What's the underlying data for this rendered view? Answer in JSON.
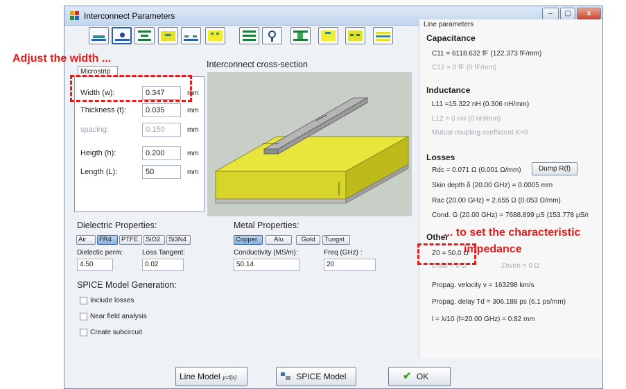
{
  "window": {
    "title": "Interconnect Parameters",
    "controls": [
      "–",
      "▢",
      "x"
    ]
  },
  "toolbar": {
    "buttons": 14,
    "selected_index": 1
  },
  "geometry": {
    "tab_label": "Microstrip",
    "section_title": "Interconnect cross-section",
    "fields": [
      {
        "label": "Width (w):",
        "value": "0.347",
        "unit": "mm",
        "enabled": true
      },
      {
        "label": "Thickness (t):",
        "value": "0.035",
        "unit": "mm",
        "enabled": true
      },
      {
        "label": "spacing:",
        "value": "0.150",
        "unit": "mm",
        "enabled": false
      },
      {
        "label": "Heigth (h):",
        "value": "0.200",
        "unit": "mm",
        "enabled": true
      },
      {
        "label": "Length (L):",
        "value": "50",
        "unit": "mm",
        "enabled": true
      }
    ]
  },
  "dielectric": {
    "title": "Dielectric Properties:",
    "chips": [
      "Air",
      "FR4",
      "PTFE",
      "SiO2",
      "Si3N4"
    ],
    "selected": "FR4",
    "perm_label": "Dielectic perm:",
    "perm_value": "4.50",
    "loss_label": "Loss Tangent:",
    "loss_value": "0.02"
  },
  "metal": {
    "title": "Metal Properties:",
    "chips": [
      "Copper",
      "Alu",
      "Gold",
      "Tungst"
    ],
    "selected": "Copper",
    "cond_label": "Conductivity (MS/m):",
    "cond_value": "50.14",
    "freq_label": "Freq (GHz) :",
    "freq_value": "20"
  },
  "spice": {
    "title": "SPICE Model Generation:",
    "checkboxes": [
      "Include losses",
      "Near field analysis",
      "Create subcircuit"
    ]
  },
  "line_params": {
    "title": "Line parameters",
    "capacitance_title": "Capacitance",
    "c11": "C11 = 6118.632 fF (122.373 fF/mm)",
    "c12": "C12 = 0 fF (0 fF/mm)",
    "inductance_title": "Inductance",
    "l11": "L11 =15.322 nH (0.306 nH/mm)",
    "l12": "L12 = 0 nH (0 nH/mm)",
    "mutual": "Mutual coupling coefficient K=0",
    "losses_title": "Losses",
    "rdc": "Rdc = 0.071 Ω (0.001 Ω/mm)",
    "dump_label": "Dump R(f)",
    "skin": "Skin depth δ (20.00 GHz) = 0.0005 mm",
    "rac": "Rac (20.00 GHz) = 2.655 Ω (0.053 Ω/mm)",
    "cond_g": "Cond. G (20.00 GHz) = 7688.899 µS (153.778 µS/r",
    "others_title": "Other",
    "z0": "Z0 = 50.0 Ω",
    "zodd": "Zodd = 0 Ω",
    "zeven": "Zeven = 0 Ω",
    "velocity": "Propag. velocity v = 163298 km/s",
    "delay": "Propag. delay Td = 306.188 ps (6.1 ps/mm)",
    "lambda": "l = λ/10 (f=20.00 GHz) = 0.82 mm"
  },
  "buttons": {
    "line_model": "Line Model",
    "line_model_suffix": "y=f(x)",
    "spice_model": "SPICE Model",
    "ok": "OK"
  },
  "annotations": {
    "left": "Adjust the width ...",
    "right_1": "... to set the characteristic",
    "right_2": "impedance"
  }
}
